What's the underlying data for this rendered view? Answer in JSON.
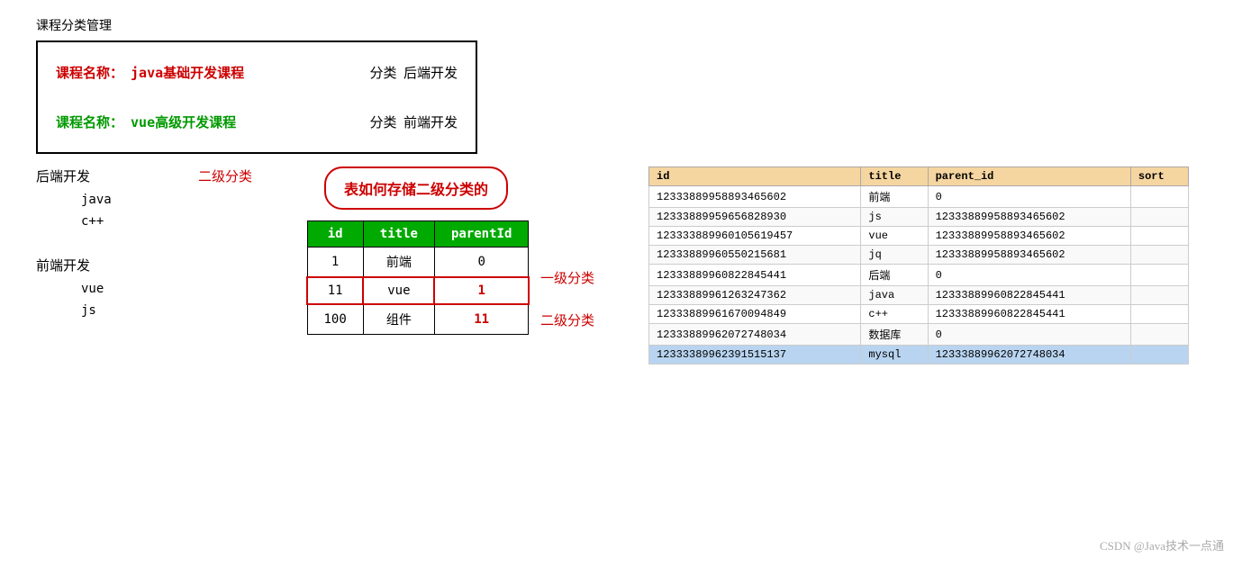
{
  "page": {
    "title": "课程分类管理",
    "watermark": "CSDN @Java技术一点通"
  },
  "courses": [
    {
      "label": "课程名称：",
      "name": "java基础开发课程",
      "category_prefix": "分类",
      "category": "后端开发",
      "color": "red"
    },
    {
      "label": "课程名称：",
      "name": "vue高级开发课程",
      "category_prefix": "分类",
      "category": "前端开发",
      "color": "green"
    }
  ],
  "tree": {
    "backend": {
      "label": "后端开发",
      "children": [
        "java",
        "c++"
      ]
    },
    "frontend": {
      "label": "前端开发",
      "children": [
        "vue",
        "js"
      ]
    }
  },
  "second_class_label": "二级分类",
  "bubble_text": "表如何存储二级分类的",
  "small_table": {
    "headers": [
      "id",
      "title",
      "parentId"
    ],
    "rows": [
      {
        "id": "1",
        "title": "前端",
        "parentId": "0",
        "highlight": false,
        "red_border": false
      },
      {
        "id": "11",
        "title": "vue",
        "parentId": "1",
        "highlight": false,
        "red_border": true
      },
      {
        "id": "100",
        "title": "组件",
        "parentId": "11",
        "highlight": false,
        "red_border": false
      }
    ]
  },
  "level1_label": "一级分类",
  "level2_label": "二级分类",
  "db_table": {
    "headers": [
      "id",
      "title",
      "parent_id",
      "sort"
    ],
    "rows": [
      {
        "id": "12333889958893465602",
        "title": "前端",
        "parent_id": "0",
        "sort": "",
        "highlight": false
      },
      {
        "id": "12333889959656828930",
        "title": "js",
        "parent_id": "12333889958893465602",
        "sort": "",
        "highlight": false
      },
      {
        "id": "123333889960105619457",
        "title": "vue",
        "parent_id": "12333889958893465602",
        "sort": "",
        "highlight": false
      },
      {
        "id": "12333889960550215681",
        "title": "jq",
        "parent_id": "12333889958893465602",
        "sort": "",
        "highlight": false
      },
      {
        "id": "12333889960822845441",
        "title": "后端",
        "parent_id": "0",
        "sort": "",
        "highlight": false
      },
      {
        "id": "12333889961263247362",
        "title": "java",
        "parent_id": "12333889960822845441",
        "sort": "",
        "highlight": false
      },
      {
        "id": "12333889961670094849",
        "title": "c++",
        "parent_id": "12333889960822845441",
        "sort": "",
        "highlight": false
      },
      {
        "id": "12333889962072748034",
        "title": "数据库",
        "parent_id": "0",
        "sort": "",
        "highlight": false
      },
      {
        "id": "12333389962391515137",
        "title": "mysql",
        "parent_id": "12333889962072748034",
        "sort": "",
        "highlight": true
      }
    ]
  }
}
